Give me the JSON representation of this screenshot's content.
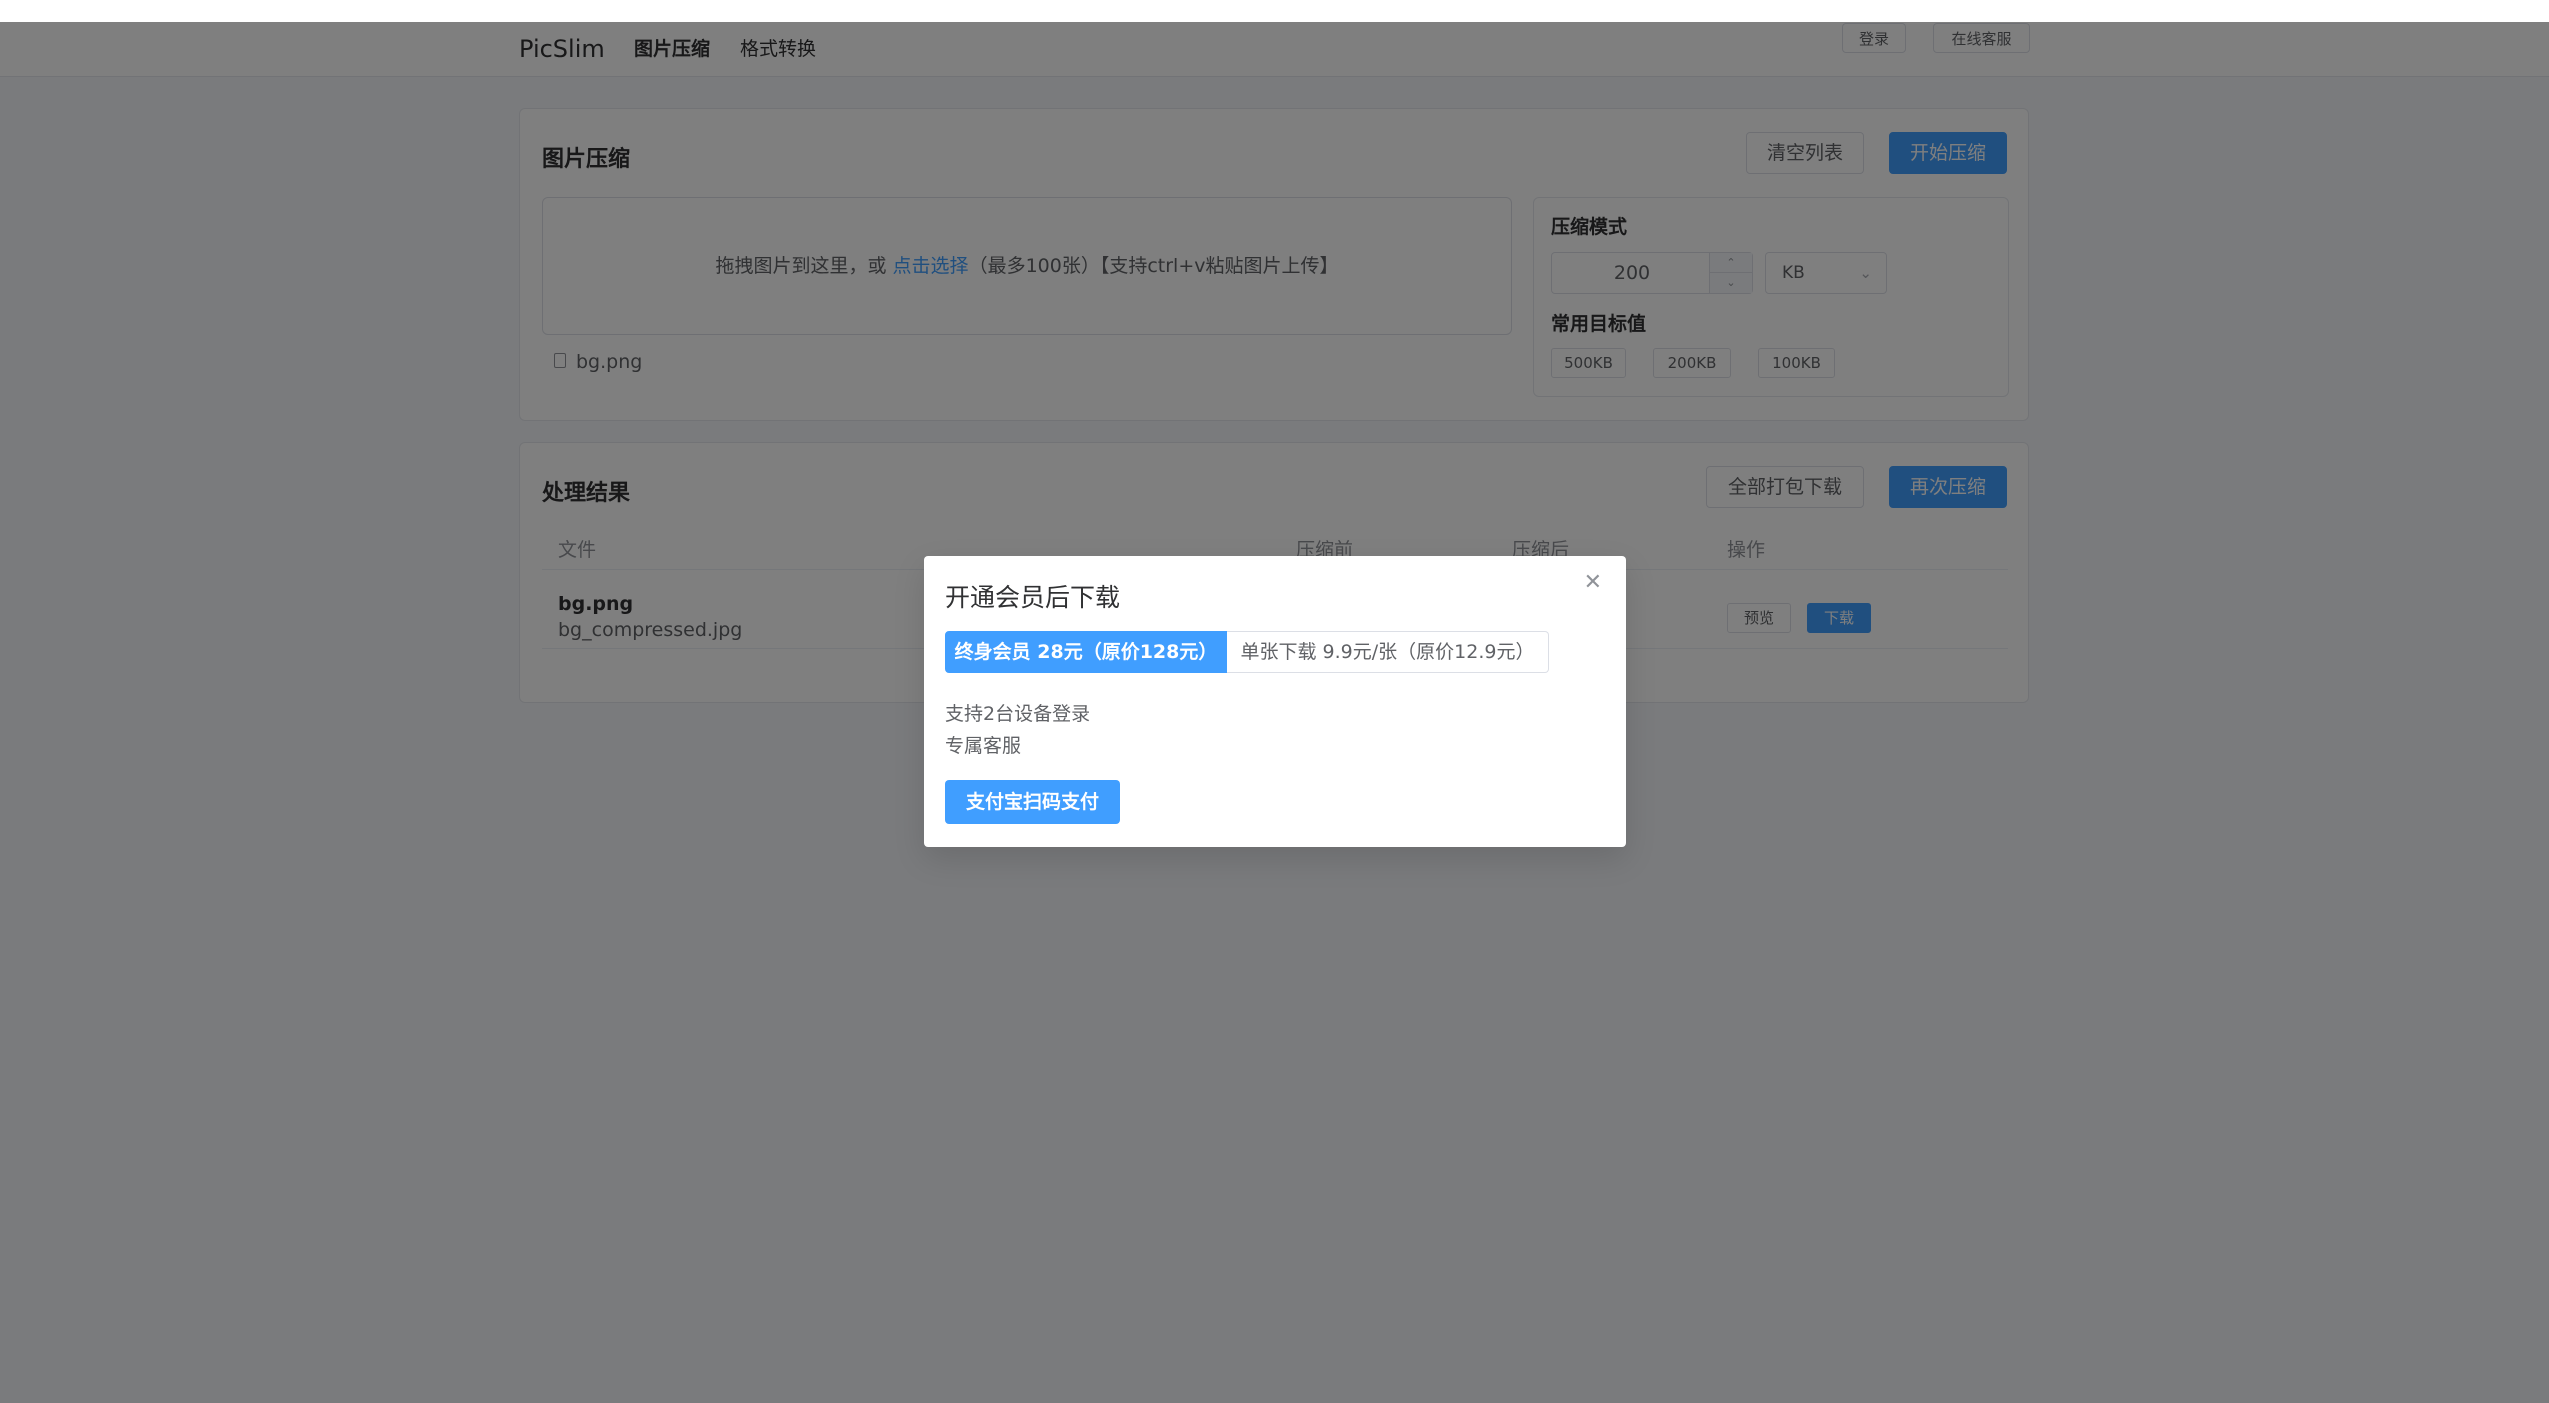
{
  "header": {
    "logo": "PicSlim",
    "nav": [
      "图片压缩",
      "格式转换"
    ],
    "login": "登录",
    "support": "在线客服"
  },
  "compress": {
    "title": "图片压缩",
    "clear_btn": "清空列表",
    "start_btn": "开始压缩",
    "drop_text_prefix": "拖拽图片到这里，或 ",
    "drop_link": "点击选择",
    "drop_text_suffix": "（最多100张）【支持ctrl+v粘贴图片上传】",
    "file": "bg.png",
    "mode_label": "压缩模式",
    "target_value": "200",
    "unit": "KB",
    "presets_label": "常用目标值",
    "presets": [
      "500KB",
      "200KB",
      "100KB"
    ]
  },
  "results": {
    "title": "处理结果",
    "download_all_btn": "全部打包下载",
    "recompress_btn": "再次压缩",
    "columns": [
      "文件",
      "压缩前",
      "压缩后",
      "操作"
    ],
    "row": {
      "name": "bg.png",
      "output": "bg_compressed.jpg",
      "preview": "预览",
      "download": "下载"
    }
  },
  "dialog": {
    "title": "开通会员后下载",
    "close_icon": "close-icon",
    "tab_lifetime": "终身会员 28元（原价128元）",
    "tab_single": "单张下载 9.9元/张（原价12.9元）",
    "features": [
      "支持2台设备登录",
      "专属客服"
    ],
    "pay_btn": "支付宝扫码支付"
  },
  "colors": {
    "primary": "#409eff",
    "overlay": "rgba(0,0,0,0.5)"
  }
}
